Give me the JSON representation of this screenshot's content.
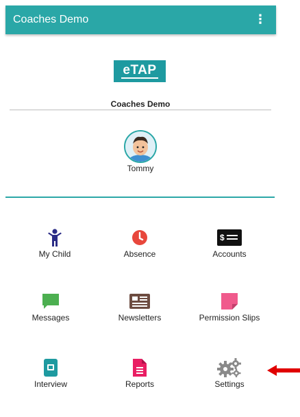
{
  "appbar": {
    "title": "Coaches Demo",
    "menu_icon": "more-vert-icon"
  },
  "logo": {
    "text": "eTAP"
  },
  "school_name": "Coaches Demo",
  "child": {
    "name": "Tommy"
  },
  "menu": [
    {
      "label": "My Child",
      "icon": "child-icon",
      "color": "#2b2c86"
    },
    {
      "label": "Absence",
      "icon": "clock-icon",
      "color": "#e8473c"
    },
    {
      "label": "Accounts",
      "icon": "cash-icon",
      "color": "#111111"
    },
    {
      "label": "Messages",
      "icon": "message-icon",
      "color": "#4caf50"
    },
    {
      "label": "Newsletters",
      "icon": "newspaper-icon",
      "color": "#6d4c41"
    },
    {
      "label": "Permission Slips",
      "icon": "sticky-note-icon",
      "color": "#f05a8c"
    },
    {
      "label": "Interview",
      "icon": "interview-icon",
      "color": "#1e9aa0"
    },
    {
      "label": "Reports",
      "icon": "report-icon",
      "color": "#e91e63"
    },
    {
      "label": "Settings",
      "icon": "gears-icon",
      "color": "#8a8a8a"
    }
  ],
  "annotation": {
    "arrow_color": "#e00000"
  }
}
